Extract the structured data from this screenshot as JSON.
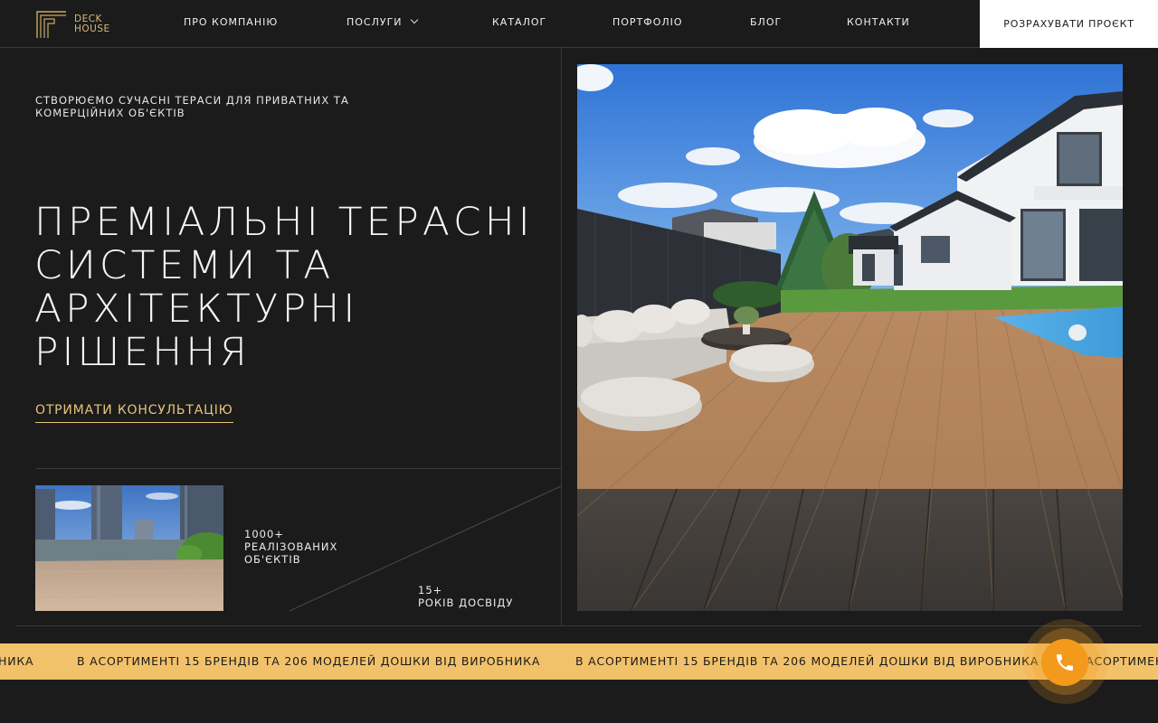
{
  "brand": {
    "name_line1": "DECK",
    "name_line2": "HOUSE"
  },
  "nav": {
    "items": [
      {
        "label": "ПРО КОМПАНІЮ"
      },
      {
        "label": "ПОСЛУГИ"
      },
      {
        "label": "КАТАЛОГ"
      },
      {
        "label": "ПОРТФОЛІО"
      },
      {
        "label": "БЛОГ"
      },
      {
        "label": "КОНТАКТИ"
      }
    ],
    "cta_label": "РОЗРАХУВАТИ ПРОЄКТ"
  },
  "hero": {
    "tagline": "СТВОРЮЄМО СУЧАСНІ ТЕРАСИ ДЛЯ ПРИВАТНИХ ТА КОМЕРЦІЙНИХ ОБ'ЄКТІВ",
    "title": "ПРЕМІАЛЬНІ ТЕРАСНІ СИСТЕМИ ТА АРХІТЕКТУРНІ РІШЕННЯ",
    "consult_label": "ОТРИМАТИ КОНСУЛЬТАЦІЮ"
  },
  "stats": [
    {
      "value": "1000+",
      "label": "РЕАЛІЗОВАНИХ ОБ'ЄКТІВ"
    },
    {
      "value": "15+",
      "label": "РОКІВ ДОСВІДУ"
    }
  ],
  "marquee": {
    "text": "В АСОРТИМЕНТІ 15 БРЕНДІВ ТА 206 МОДЕЛЕЙ ДОШКИ ВІД ВИРОБНИКА",
    "fragment_left": "НИКА",
    "fragment_right": "В АСОРТИМЕНТІ"
  },
  "colors": {
    "background": "#1b1b1b",
    "accent_gold": "#e7c47a",
    "band_yellow": "#f2c26b",
    "call_orange": "#f39a1c"
  },
  "icons": {
    "logo": "logo-icon",
    "chevron": "chevron-down-icon",
    "phone": "phone-icon"
  }
}
